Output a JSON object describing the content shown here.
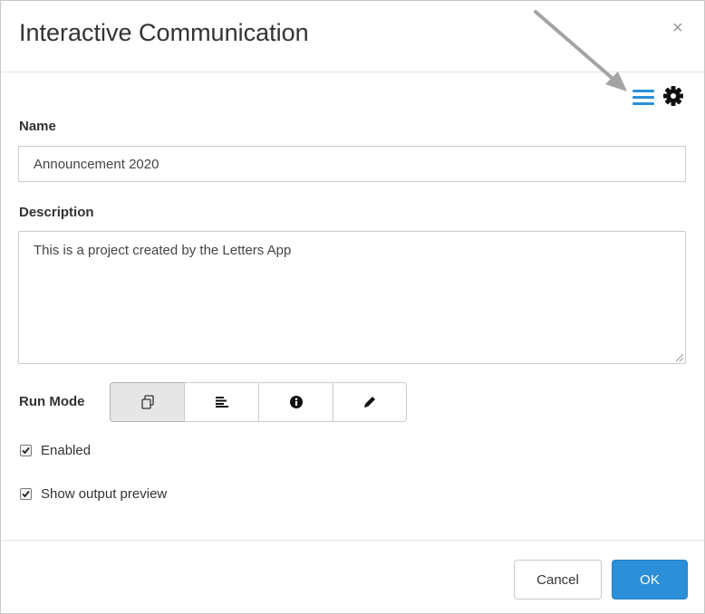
{
  "dialog": {
    "title": "Interactive Communication",
    "close_label": "×"
  },
  "toolbar": {
    "icons": [
      "menu-icon",
      "gear-icon"
    ],
    "accent_color": "#2b8fd9"
  },
  "form": {
    "name_label": "Name",
    "name_value": "Announcement 2020",
    "description_label": "Description",
    "description_value": "This is a project created by the Letters App",
    "run_mode_label": "Run Mode",
    "run_modes": [
      {
        "icon": "copy-icon",
        "selected": true
      },
      {
        "icon": "align-left-icon",
        "selected": false
      },
      {
        "icon": "info-icon",
        "selected": false
      },
      {
        "icon": "pencil-icon",
        "selected": false
      }
    ],
    "checkboxes": [
      {
        "label": "Enabled",
        "checked": true
      },
      {
        "label": "Show output preview",
        "checked": true
      }
    ]
  },
  "footer": {
    "cancel_label": "Cancel",
    "ok_label": "OK"
  }
}
